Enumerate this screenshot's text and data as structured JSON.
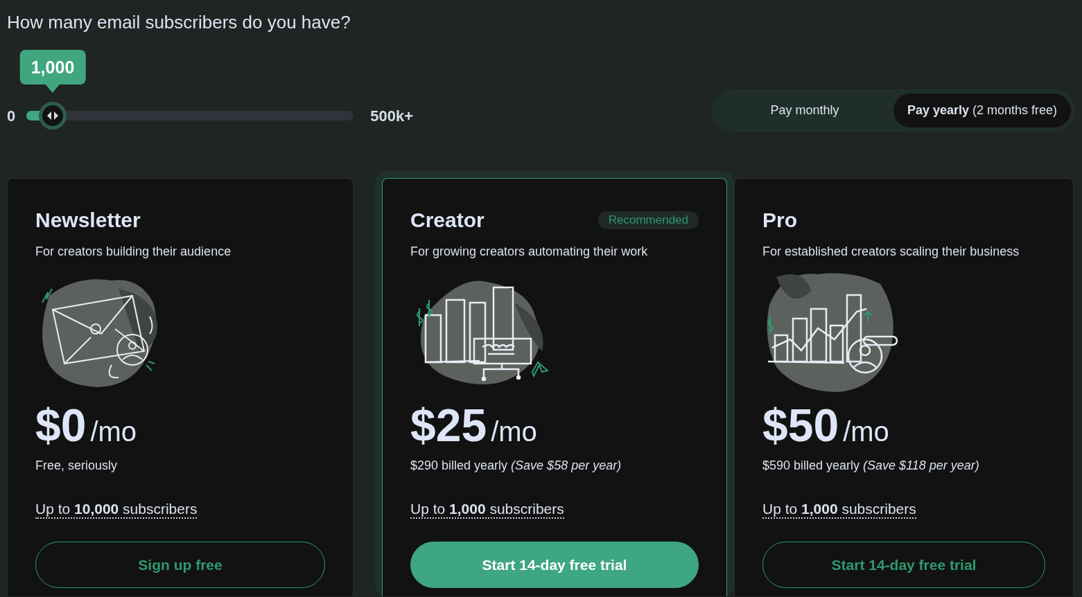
{
  "heading": "How many email subscribers do you have?",
  "slider": {
    "tooltip": "1,000",
    "min_label": "0",
    "max_label": "500k+",
    "level": 0.08
  },
  "billing_toggle": [
    {
      "label": "Pay monthly",
      "selected": false
    },
    {
      "label": "**Pay yearly** (2 months free)",
      "selected": true
    }
  ],
  "plans": [
    {
      "kind": "envelope",
      "name": "Newsletter",
      "description": "For creators building their audience",
      "recommended": false,
      "price": "$0",
      "period": "/mo",
      "billing": "Free, seriously",
      "limit": "Up to **10,000** subscribers",
      "button": "Sign up free"
    },
    {
      "kind": "bar-chart",
      "name": "Creator",
      "badge": "Recommended",
      "description": "For growing creators automating their work",
      "recommended": true,
      "price": "$25",
      "period": "/mo",
      "billing": "$290 billed yearly *(Save $58 per year)*",
      "limit": "Up to **1,000** subscribers",
      "button": "Start 14-day free trial"
    },
    {
      "kind": "growth-chart",
      "name": "Pro",
      "description": "For established creators scaling their business",
      "recommended": false,
      "price": "$50",
      "period": "/mo",
      "billing": "$590 billed yearly *(Save $118 per year)*",
      "limit": "Up to **1,000** subscribers",
      "button": "Start 14-day free trial"
    }
  ]
}
